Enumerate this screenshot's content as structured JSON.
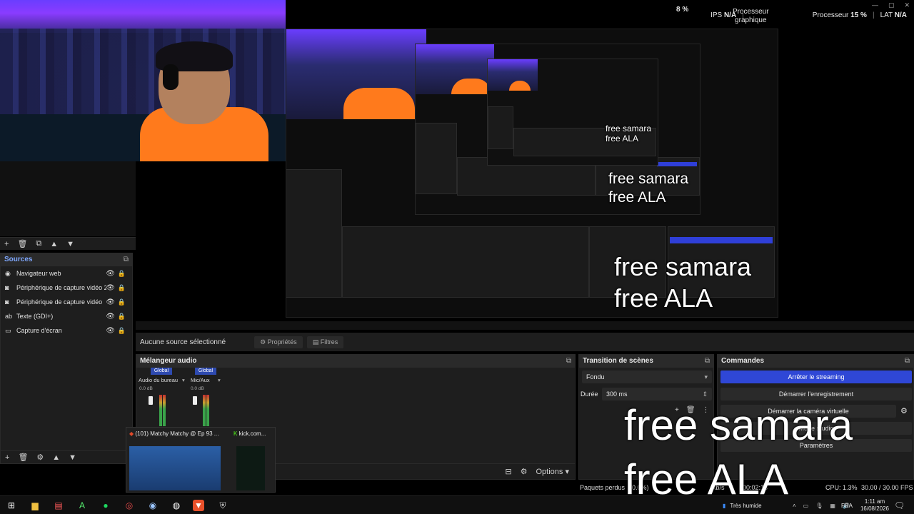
{
  "stats": {
    "processeur_graphique_label": "Processeur\ngraphique",
    "gpu_percent": "8 %",
    "ips_label": "IPS",
    "ips_value": "N/A",
    "processeur_label": "Processeur",
    "cpu_percent": "15 %",
    "lat_label": "LAT",
    "lat_value": "N/A"
  },
  "sources": {
    "title": "Sources",
    "items": [
      {
        "icon": "globe-icon",
        "glyph": "◉",
        "label": "Navigateur web"
      },
      {
        "icon": "camera-icon",
        "glyph": "◙",
        "label": "Périphérique de capture vidéo 2"
      },
      {
        "icon": "camera-icon",
        "glyph": "◙",
        "label": "Périphérique de capture vidéo"
      },
      {
        "icon": "text-icon",
        "glyph": "ab",
        "label": "Texte (GDI+)"
      },
      {
        "icon": "monitor-icon",
        "glyph": "▭",
        "label": "Capture d'écran"
      }
    ]
  },
  "props_bar": {
    "no_source": "Aucune source sélectionné",
    "properties": "Propriétés",
    "filters": "Filtres"
  },
  "mixer": {
    "title": "Mélangeur audio",
    "channels": [
      {
        "head": "Global",
        "name": "Audio du bureau",
        "db": "0.0 dB"
      },
      {
        "head": "Global",
        "name": "Mic/Aux",
        "db": "0.0 dB"
      }
    ],
    "options": "Options"
  },
  "transition": {
    "title": "Transition de scènes",
    "mode": "Fondu",
    "duration_label": "Durée",
    "duration_value": "300 ms"
  },
  "commands": {
    "title": "Commandes",
    "buttons": [
      "Arrêter le streaming",
      "Démarrer l'enregistrement",
      "Démarrer la caméra virtuelle",
      "Mode studio",
      "Paramètres"
    ]
  },
  "status": {
    "frames_lost": "Paquets perdus",
    "frames_lost_value": "(0.0%)",
    "kbps": "kb/s",
    "time": "00:02:18",
    "cpu": "CPU: 1.3%",
    "fps": "30.00 / 30.00 FPS"
  },
  "thumbs": {
    "tab1": "(101) Matchy Matchy @ Ep 93 ...",
    "tab2": "kick.com..."
  },
  "taskbar": {
    "weather": "Très humide",
    "lang": "FRA",
    "time": "1:11 am",
    "date": "16/08/2026"
  },
  "overlays": {
    "line1": "free samara",
    "line2": "free ALA"
  },
  "colors": {
    "accent_blue": "#2f47d6",
    "shirt_orange": "#ff7a1c",
    "led_purple": "#6a3dff"
  }
}
